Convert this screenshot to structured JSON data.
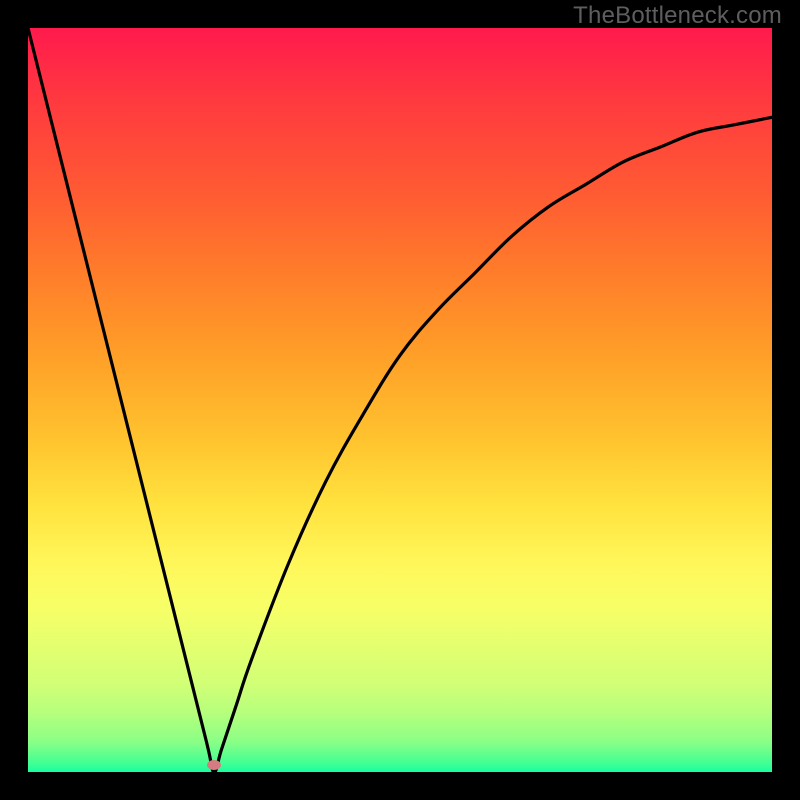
{
  "watermark": "TheBottleneck.com",
  "chart_data": {
    "type": "line",
    "title": "",
    "xlabel": "",
    "ylabel": "",
    "xlim": [
      0,
      100
    ],
    "ylim": [
      0,
      100
    ],
    "series": [
      {
        "name": "bottleneck-curve",
        "x": [
          0,
          5,
          10,
          15,
          20,
          24,
          25,
          26,
          28,
          30,
          35,
          40,
          45,
          50,
          55,
          60,
          65,
          70,
          75,
          80,
          85,
          90,
          95,
          100
        ],
        "values": [
          100,
          80,
          60,
          40,
          20,
          4,
          0,
          3,
          9,
          15,
          28,
          39,
          48,
          56,
          62,
          67,
          72,
          76,
          79,
          82,
          84,
          86,
          87,
          88
        ]
      }
    ],
    "marker": {
      "x": 25,
      "y": 1
    },
    "grid": false,
    "background_gradient": {
      "top": "#ff1a4d",
      "bottom": "#16ffa0"
    }
  }
}
